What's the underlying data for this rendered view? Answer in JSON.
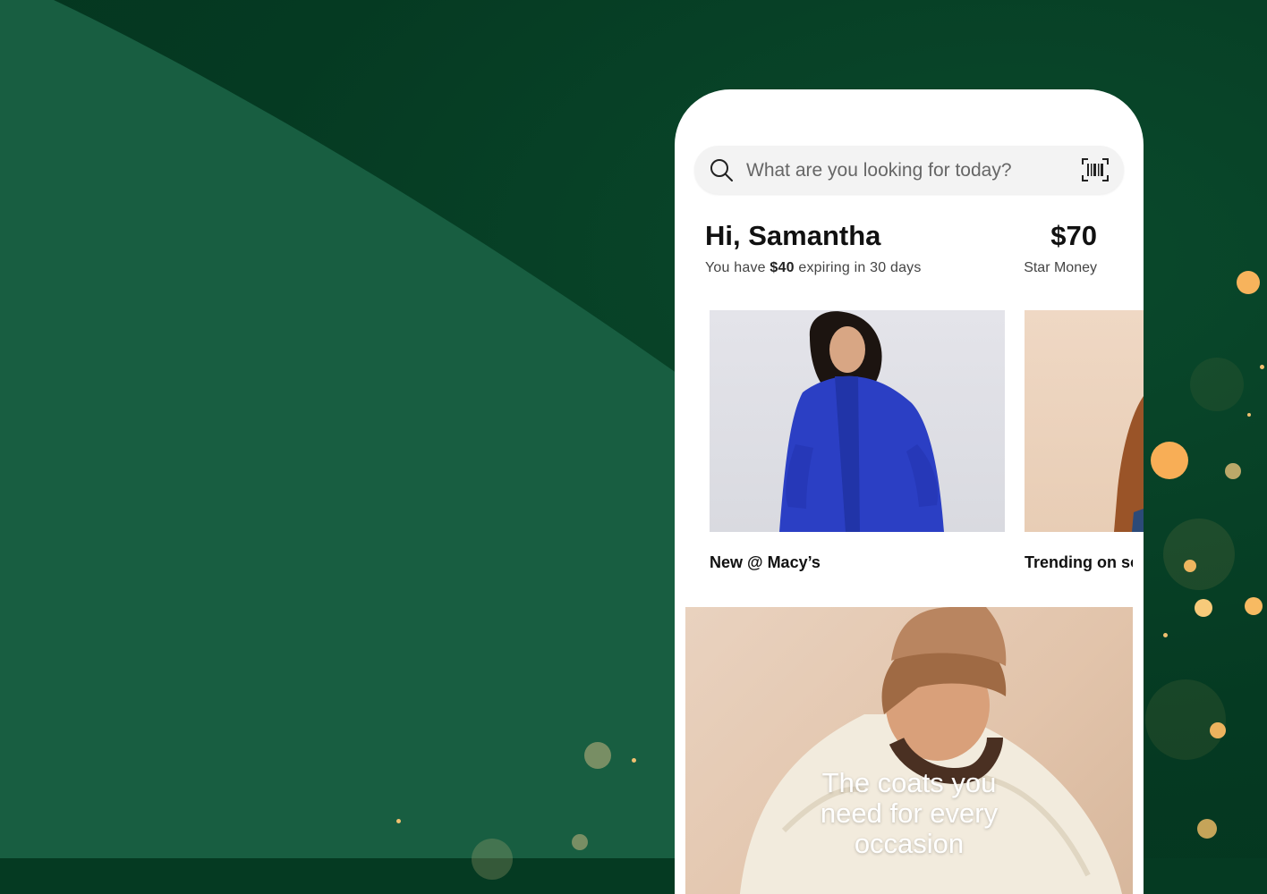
{
  "search": {
    "placeholder": "What are you looking for today?",
    "search_icon": "search-icon",
    "scan_icon": "barcode-scan-icon"
  },
  "account": {
    "greeting": "Hi, Samantha",
    "expiring_prefix": "You have",
    "expiring_amount": "$40",
    "expiring_suffix": "expiring in 30 days",
    "star_money_amount": "$70",
    "star_money_label": "Star Money"
  },
  "carousel": [
    {
      "label": "New @ Macy’s"
    },
    {
      "label": "Trending on so"
    }
  ],
  "banner": {
    "text": "The coats you need for every occasion"
  },
  "colors": {
    "background": "#053a22",
    "wave": "#185e41",
    "sparkle": "#f6b25a"
  }
}
